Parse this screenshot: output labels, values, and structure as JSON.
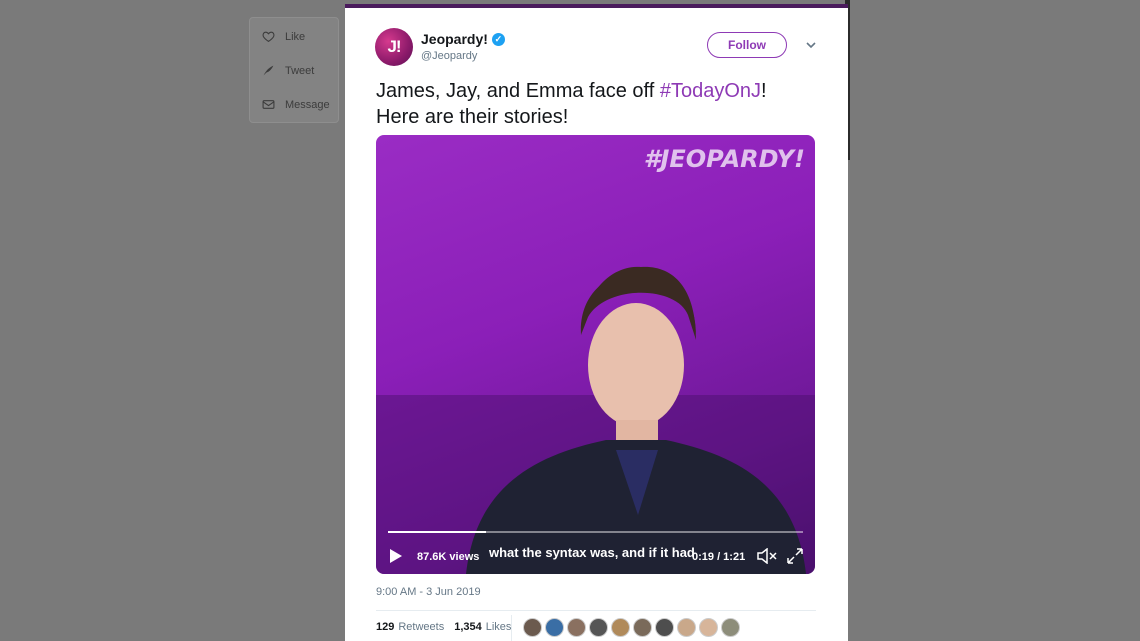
{
  "side_actions": [
    {
      "label": "Like",
      "icon": "heart-icon"
    },
    {
      "label": "Tweet",
      "icon": "quill-icon"
    },
    {
      "label": "Message",
      "icon": "envelope-icon"
    }
  ],
  "tweet": {
    "avatar_text": "J!",
    "display_name": "Jeopardy!",
    "handle": "@Jeopardy",
    "follow_label": "Follow",
    "text_plain": "James, Jay, and Emma face off ",
    "hashtag": "#TodayOnJ",
    "text_after_hashtag": "!",
    "text_line2": "Here are their stories!",
    "timestamp": "9:00 AM - 3 Jun 2019",
    "retweets_count": "129",
    "retweets_label": "Retweets",
    "likes_count": "1,354",
    "likes_label": "Likes"
  },
  "video": {
    "watermark": "#JEOPARDY!",
    "views": "87.6K views",
    "subtitle": "what the syntax was, and if it had",
    "time": "0:19 / 1:21",
    "progress": 0.235
  },
  "colors": {
    "accent": "#8e3ab5",
    "verified": "#1da1f2",
    "backdrop": "#7a7a7a"
  },
  "liker_avatar_colors": [
    "#6b5a4e",
    "#3a6ea5",
    "#8a7060",
    "#555555",
    "#b08a5a",
    "#7a6a5a",
    "#4e4e4e",
    "#c9a88a",
    "#d7b59a",
    "#8d8d7a"
  ]
}
